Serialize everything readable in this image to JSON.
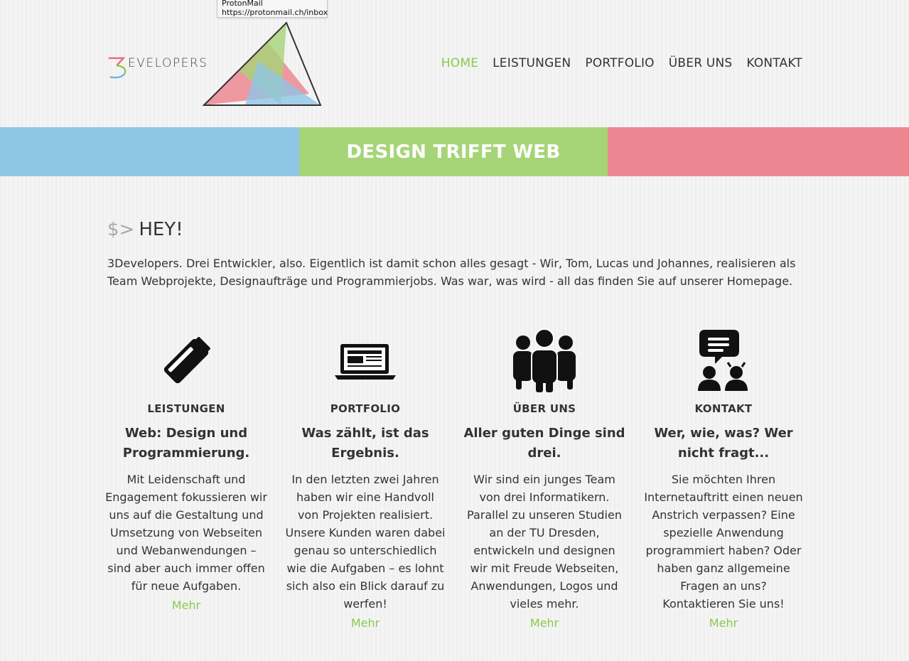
{
  "tooltip": {
    "line1": "ProtonMail",
    "line2": "https://protonmail.ch/inbox"
  },
  "brand": {
    "logo_text": "EVELOPERS",
    "logo_glyph": "3"
  },
  "nav": [
    {
      "label": "HOME",
      "active": true
    },
    {
      "label": "LEISTUNGEN",
      "active": false
    },
    {
      "label": "PORTFOLIO",
      "active": false
    },
    {
      "label": "ÜBER UNS",
      "active": false
    },
    {
      "label": "KONTAKT",
      "active": false
    }
  ],
  "banner": {
    "title": "DESIGN TRIFFT WEB"
  },
  "colors": {
    "accent": "#8cc84b",
    "blue": "#8ec6e5",
    "green": "#a6d577",
    "pink": "#ec8792"
  },
  "intro": {
    "prompt": "$>",
    "heading": "HEY!",
    "text": "3Developers. Drei Entwickler, also. Eigentlich ist damit schon alles gesagt - Wir, Tom, Lucas und Johannes, realisieren als Team Webprojekte, Designaufträge und Programmierjobs. Was war, was wird - all das finden Sie auf unserer Homepage."
  },
  "features": [
    {
      "icon": "usb-stick-icon",
      "label": "LEISTUNGEN",
      "title": "Web: Design und Programmierung.",
      "text": "Mit Leidenschaft und Engagement fokussieren wir uns auf die Gestaltung und Umsetzung von Webseiten und Webanwendungen – sind aber auch immer offen für neue Aufgaben.",
      "more": "Mehr"
    },
    {
      "icon": "laptop-icon",
      "label": "PORTFOLIO",
      "title": "Was zählt, ist das Ergebnis.",
      "text": "In den letzten zwei Jahren haben wir eine Handvoll von Projekten realisiert. Unsere Kunden waren dabei genau so unterschiedlich wie die Aufgaben – es lohnt sich also ein Blick darauf zu werfen!",
      "more": "Mehr"
    },
    {
      "icon": "team-icon",
      "label": "ÜBER UNS",
      "title": "Aller guten Dinge sind drei.",
      "text": "Wir sind ein junges Team von drei Informatikern. Parallel zu unseren Studien an der TU Dresden, entwickeln und designen wir mit Freude Webseiten, Anwendungen, Logos und vieles mehr.",
      "more": "Mehr"
    },
    {
      "icon": "chat-people-icon",
      "label": "KONTAKT",
      "title": "Wer, wie, was? Wer nicht fragt...",
      "text": "Sie möchten Ihren Internetauftritt einen neuen Anstrich verpassen? Eine spezielle Anwendung programmiert haben? Oder haben ganz allgemeine Fragen an uns? Kontaktieren Sie uns!",
      "more": "Mehr"
    }
  ]
}
